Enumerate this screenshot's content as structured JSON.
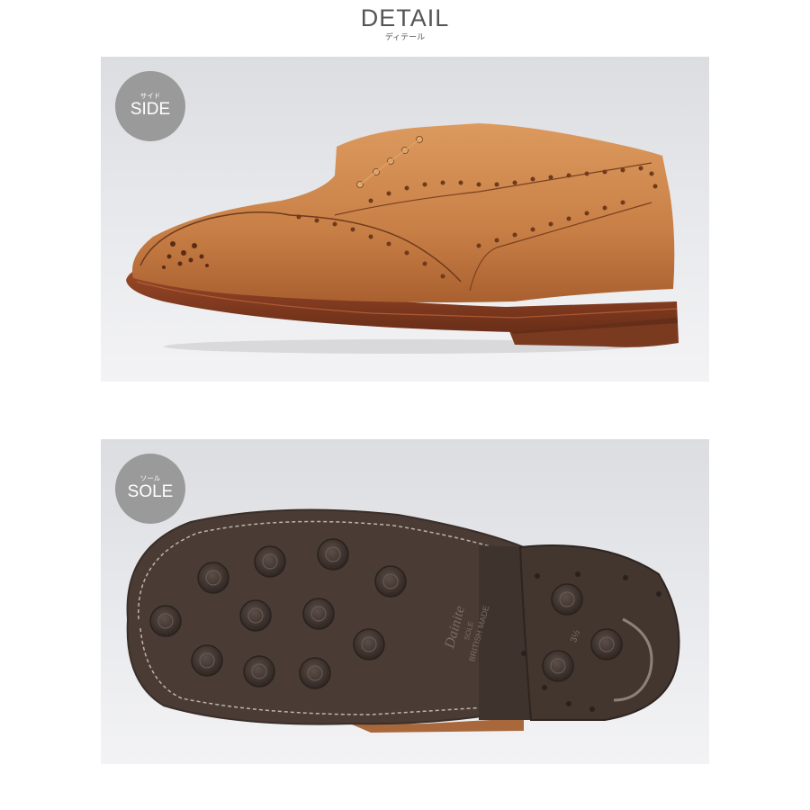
{
  "header": {
    "title": "DETAIL",
    "subtitle": "ディテール"
  },
  "panels": [
    {
      "id": "side",
      "badge_jp": "サイド",
      "badge_en": "SIDE"
    },
    {
      "id": "sole",
      "badge_jp": "ソール",
      "badge_en": "SOLE",
      "sole_brand": "Dainite",
      "sole_text": "SOLE",
      "sole_made": "BRITISH MADE",
      "sole_size": "3½"
    }
  ],
  "colors": {
    "leather": "#c8844d",
    "welt": "#8a3f22",
    "rubber": "#4a3c34",
    "badge": "#9a9a9a"
  }
}
